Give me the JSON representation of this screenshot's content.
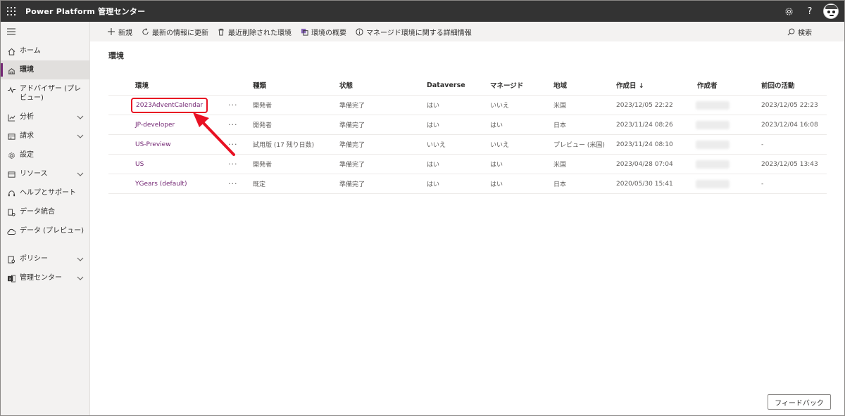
{
  "app": {
    "title": "Power Platform 管理センター"
  },
  "topbar": {
    "settings_icon": "gear-icon",
    "help_label": "?",
    "avatar": "user-avatar"
  },
  "sidebar": {
    "items": [
      {
        "label": "ホーム",
        "icon": "home-icon",
        "chevron": false,
        "active": false
      },
      {
        "label": "環境",
        "icon": "environment-icon",
        "chevron": false,
        "active": true
      },
      {
        "label": "アドバイザー (プレビュー)",
        "icon": "pulse-icon",
        "chevron": false,
        "active": false
      },
      {
        "label": "分析",
        "icon": "chart-icon",
        "chevron": true,
        "active": false
      },
      {
        "label": "請求",
        "icon": "billing-icon",
        "chevron": true,
        "active": false
      },
      {
        "label": "設定",
        "icon": "gear-icon",
        "chevron": false,
        "active": false
      },
      {
        "label": "リソース",
        "icon": "resources-icon",
        "chevron": true,
        "active": false
      },
      {
        "label": "ヘルプとサポート",
        "icon": "headset-icon",
        "chevron": false,
        "active": false
      },
      {
        "label": "データ統合",
        "icon": "data-integration-icon",
        "chevron": false,
        "active": false
      },
      {
        "label": "データ (プレビュー)",
        "icon": "cloud-icon",
        "chevron": false,
        "active": false
      },
      {
        "label": "ポリシー",
        "icon": "policy-icon",
        "chevron": true,
        "active": false
      },
      {
        "label": "管理センター",
        "icon": "admin-center-icon",
        "chevron": true,
        "active": false
      }
    ]
  },
  "toolbar": {
    "new_label": "新規",
    "refresh_label": "最新の情報に更新",
    "deleted_label": "最近削除された環境",
    "overview_label": "環境の概要",
    "managed_info_label": "マネージド環境に関する詳細情報",
    "search_label": "検索"
  },
  "page": {
    "title": "環境"
  },
  "table": {
    "headers": {
      "env": "環境",
      "type": "種類",
      "state": "状態",
      "dataverse": "Dataverse",
      "managed": "マネージド",
      "region": "地域",
      "created": "作成日 ↓",
      "creator": "作成者",
      "last_activity": "前回の活動"
    },
    "more_label": "···",
    "rows": [
      {
        "env": "2023AdventCalendar",
        "type": "開発者",
        "state": "準備完了",
        "dataverse": "はい",
        "managed": "いいえ",
        "region": "米国",
        "created": "2023/12/05 22:22",
        "last_activity": "2023/12/05 22:23"
      },
      {
        "env": "JP-developer",
        "type": "開発者",
        "state": "準備完了",
        "dataverse": "はい",
        "managed": "はい",
        "region": "日本",
        "created": "2023/11/24 08:26",
        "last_activity": "2023/12/04 16:08"
      },
      {
        "env": "US-Preview",
        "type": "試用版 (17 残り日数)",
        "state": "準備完了",
        "dataverse": "いいえ",
        "managed": "いいえ",
        "region": "プレビュー (米国)",
        "created": "2023/11/24 08:10",
        "last_activity": "-"
      },
      {
        "env": "US",
        "type": "開発者",
        "state": "準備完了",
        "dataverse": "はい",
        "managed": "はい",
        "region": "米国",
        "created": "2023/04/28 07:04",
        "last_activity": "2023/12/05 13:43"
      },
      {
        "env": "YGears (default)",
        "type": "既定",
        "state": "準備完了",
        "dataverse": "はい",
        "managed": "はい",
        "region": "日本",
        "created": "2020/05/30 15:41",
        "last_activity": "-"
      }
    ]
  },
  "feedback": {
    "label": "フィードバック"
  },
  "colors": {
    "accent": "#742774",
    "highlight": "#e81123",
    "topbar": "#333333"
  }
}
